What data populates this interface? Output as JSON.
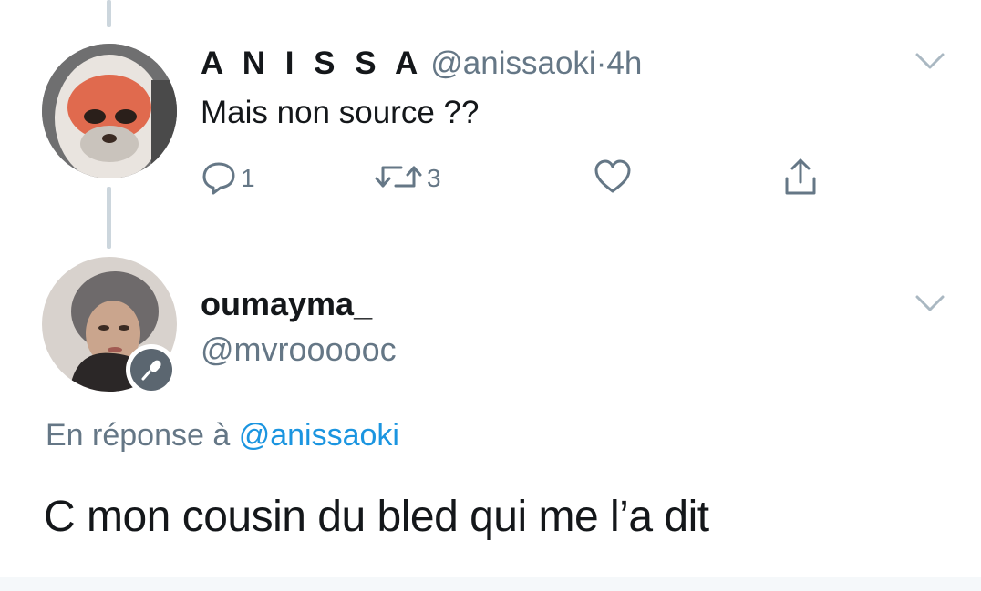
{
  "tweet1": {
    "display_name": "A N I S S A",
    "handle": "@anissaoki",
    "separator": "·",
    "time": "4h",
    "text": "Mais non source ??",
    "actions": {
      "reply_count": "1",
      "retweet_count": "3"
    },
    "icons": [
      "reply-icon",
      "retweet-icon",
      "like-icon",
      "share-icon",
      "chevron-down-icon"
    ]
  },
  "tweet2": {
    "display_name": "oumayma_",
    "handle": "@mvroooooc",
    "reply_prefix": "En réponse à",
    "reply_mention": "@anissaoki",
    "text": "C mon cousin du bled qui me l’a dit",
    "badge_icon": "microphone-icon"
  },
  "colors": {
    "primary_text": "#14171a",
    "secondary_text": "#657786",
    "link": "#1b95e0",
    "thread_line": "#ccd6dd"
  }
}
